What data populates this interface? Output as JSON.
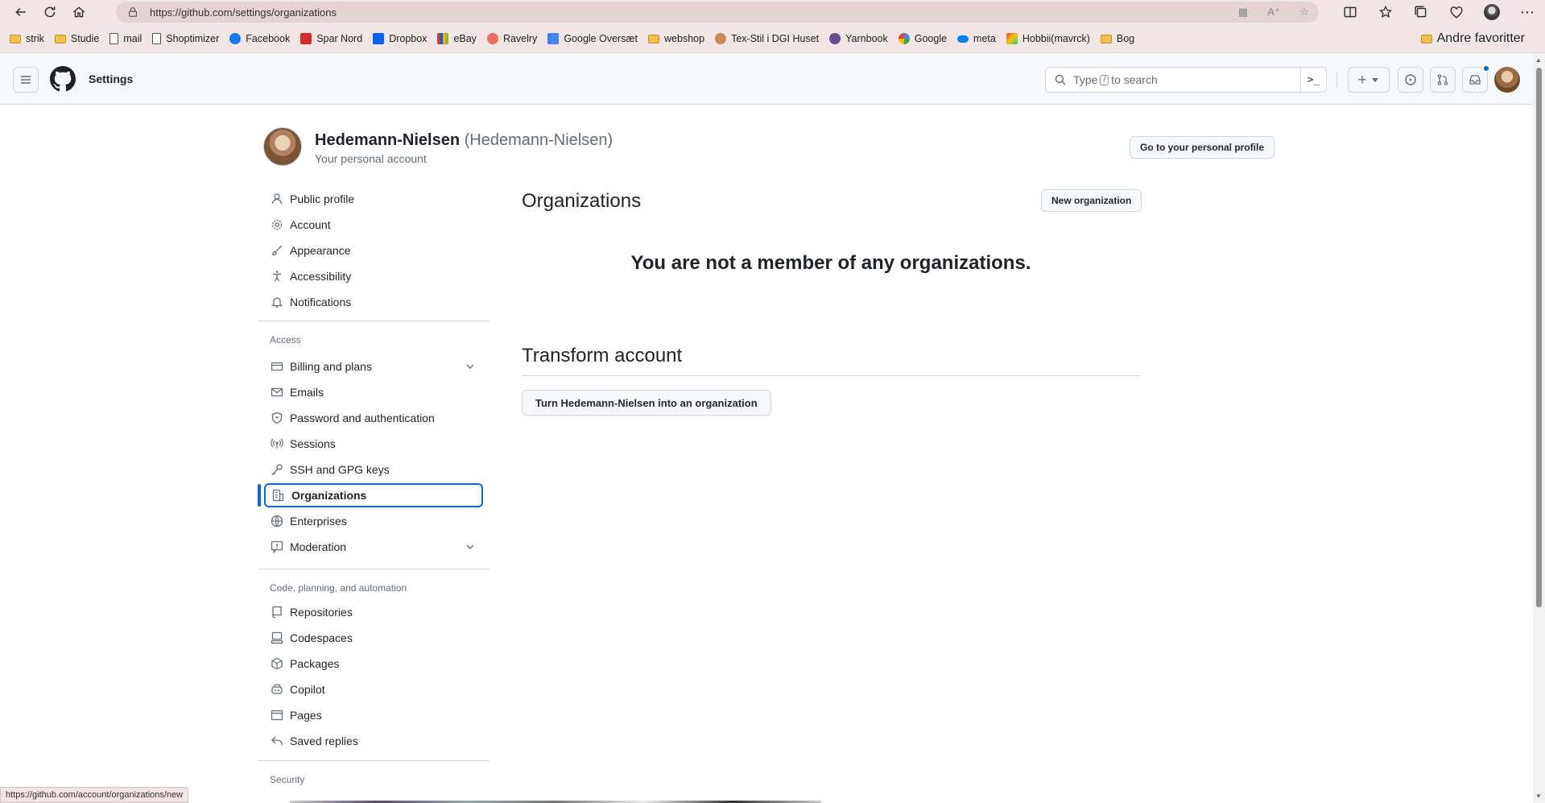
{
  "browser": {
    "url": "https://github.com/settings/organizations",
    "bookmarks": [
      {
        "label": "strik",
        "icon": "folder"
      },
      {
        "label": "Studie",
        "icon": "folder"
      },
      {
        "label": "mail",
        "icon": "doc"
      },
      {
        "label": "Shoptimizer",
        "icon": "doc"
      },
      {
        "label": "Facebook",
        "icon": "fb"
      },
      {
        "label": "Spar Nord",
        "icon": "red"
      },
      {
        "label": "Dropbox",
        "icon": "db"
      },
      {
        "label": "eBay",
        "icon": "ebay"
      },
      {
        "label": "Ravelry",
        "icon": "rav"
      },
      {
        "label": "Google Oversæt",
        "icon": "gt"
      },
      {
        "label": "webshop",
        "icon": "folder"
      },
      {
        "label": "Tex-Stil i DGI Huset",
        "icon": "tex"
      },
      {
        "label": "Yarnbook",
        "icon": "yarn"
      },
      {
        "label": "Google",
        "icon": "g"
      },
      {
        "label": "meta",
        "icon": "meta"
      },
      {
        "label": "Hobbii(mavrck)",
        "icon": "hob"
      },
      {
        "label": "Bog",
        "icon": "folder"
      }
    ],
    "other_favorites": "Andre favoritter",
    "status_url": "https://github.com/account/organizations/new"
  },
  "header": {
    "title": "Settings",
    "search_prefix": "Type",
    "search_key": "/",
    "search_suffix": "to search",
    "new_symbol": "+"
  },
  "profile": {
    "name": "Hedemann-Nielsen",
    "login": "(Hedemann-Nielsen)",
    "subtitle": "Your personal account",
    "go_profile_label": "Go to your personal profile"
  },
  "sidebar": {
    "group1": [
      {
        "label": "Public profile",
        "icon": "person-icon"
      },
      {
        "label": "Account",
        "icon": "gear-icon"
      },
      {
        "label": "Appearance",
        "icon": "paintbrush-icon"
      },
      {
        "label": "Accessibility",
        "icon": "accessibility-icon"
      },
      {
        "label": "Notifications",
        "icon": "bell-icon"
      }
    ],
    "access_heading": "Access",
    "group2": [
      {
        "label": "Billing and plans",
        "icon": "credit-card-icon"
      },
      {
        "label": "Emails",
        "icon": "mail-icon"
      },
      {
        "label": "Password and authentication",
        "icon": "shield-icon"
      },
      {
        "label": "Sessions",
        "icon": "broadcast-icon"
      },
      {
        "label": "SSH and GPG keys",
        "icon": "key-icon"
      },
      {
        "label": "Organizations",
        "icon": "organization-icon"
      },
      {
        "label": "Enterprises",
        "icon": "globe-icon"
      },
      {
        "label": "Moderation",
        "icon": "report-icon"
      }
    ],
    "code_heading": "Code, planning, and automation",
    "group3": [
      {
        "label": "Repositories",
        "icon": "repo-icon"
      },
      {
        "label": "Codespaces",
        "icon": "codespaces-icon"
      },
      {
        "label": "Packages",
        "icon": "package-icon"
      },
      {
        "label": "Copilot",
        "icon": "copilot-icon"
      },
      {
        "label": "Pages",
        "icon": "browser-icon"
      },
      {
        "label": "Saved replies",
        "icon": "reply-icon"
      }
    ],
    "security_heading": "Security"
  },
  "main": {
    "organizations_title": "Organizations",
    "new_org_label": "New organization",
    "blank_message": "You are not a member of any organizations.",
    "transform_title": "Transform account",
    "turn_into_org_label": "Turn Hedemann-Nielsen into an organization"
  },
  "colors": {
    "accent": "#0969da",
    "border": "#d0d7de",
    "muted_text": "#656d76",
    "browser_chrome": "#f0e6e6"
  }
}
